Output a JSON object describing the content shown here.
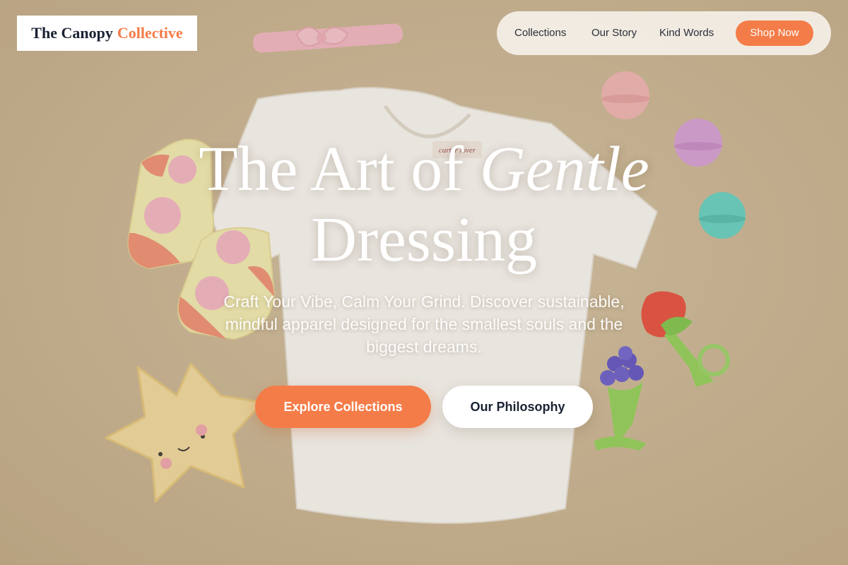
{
  "brand": {
    "name_part1": "The Canopy",
    "name_part2": "Collective",
    "accent": "#f47c48"
  },
  "nav": {
    "links": [
      "Collections",
      "Our Story",
      "Kind Words"
    ],
    "cta_label": "Shop Now"
  },
  "hero": {
    "title_part1": "The Art of",
    "title_italic": "Gentle",
    "title_part2": "Dressing",
    "subtitle": "Craft Your Vibe, Calm Your Grind. Discover sustainable, mindful apparel designed for the smallest souls and the biggest dreams.",
    "primary_cta": "Explore Collections",
    "secondary_cta": "Our Philosophy",
    "background_image": "baby-flatlay-photo"
  },
  "tshirt_label": "carter lover"
}
